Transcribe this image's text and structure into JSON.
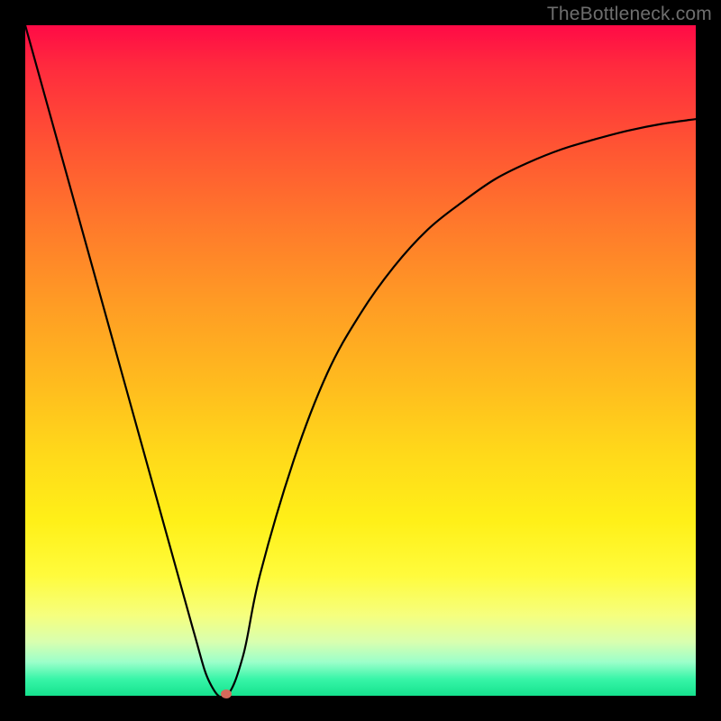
{
  "watermark": "TheBottleneck.com",
  "colors": {
    "frame": "#000000",
    "curve": "#000000",
    "marker": "#d4695a"
  },
  "chart_data": {
    "type": "line",
    "title": "",
    "xlabel": "",
    "ylabel": "",
    "xlim": [
      0,
      100
    ],
    "ylim": [
      0,
      100
    ],
    "grid": false,
    "series": [
      {
        "name": "bottleneck-curve",
        "x": [
          0,
          5,
          10,
          15,
          20,
          25,
          27.5,
          30,
          32.5,
          35,
          40,
          45,
          50,
          55,
          60,
          65,
          70,
          75,
          80,
          85,
          90,
          95,
          100
        ],
        "values": [
          100,
          82,
          64,
          46,
          28,
          10,
          2,
          0,
          6,
          18,
          35,
          48,
          57,
          64,
          69.5,
          73.5,
          77,
          79.5,
          81.5,
          83,
          84.3,
          85.3,
          86
        ]
      }
    ],
    "marker": {
      "x": 30,
      "y": 0
    },
    "gradient_stops": [
      {
        "pct": 0,
        "color": "#ff0a46"
      },
      {
        "pct": 18,
        "color": "#ff5433"
      },
      {
        "pct": 42,
        "color": "#ff9d24"
      },
      {
        "pct": 64,
        "color": "#ffd91a"
      },
      {
        "pct": 82,
        "color": "#fffb3c"
      },
      {
        "pct": 95,
        "color": "#9bffca"
      },
      {
        "pct": 100,
        "color": "#15e28e"
      }
    ]
  }
}
